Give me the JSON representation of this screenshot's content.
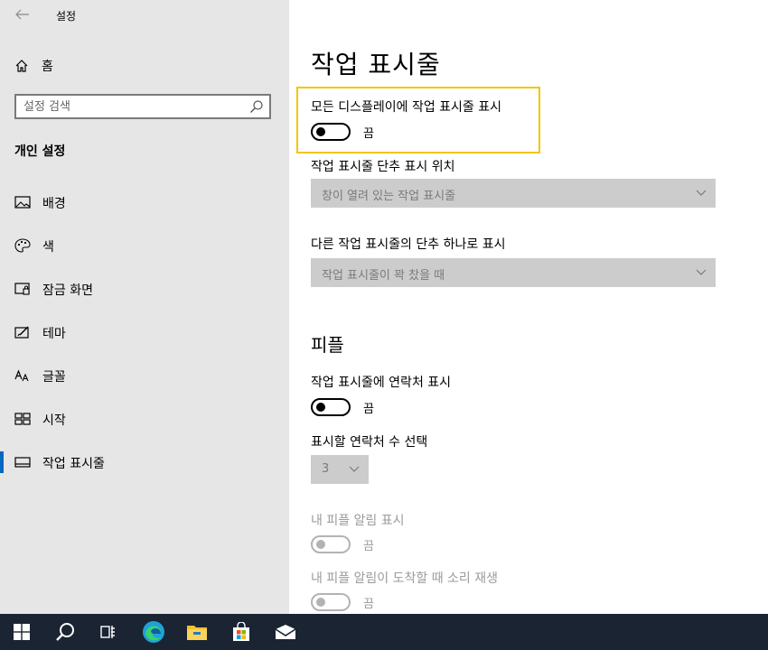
{
  "window": {
    "title": "설정"
  },
  "sidebar": {
    "home_label": "홈",
    "search_placeholder": "설정 검색",
    "section_title": "개인 설정",
    "items": [
      {
        "label": "배경",
        "icon": "picture-icon"
      },
      {
        "label": "색",
        "icon": "palette-icon"
      },
      {
        "label": "잠금 화면",
        "icon": "lock-screen-icon"
      },
      {
        "label": "테마",
        "icon": "theme-icon"
      },
      {
        "label": "글꼴",
        "icon": "font-icon"
      },
      {
        "label": "시작",
        "icon": "start-icon"
      },
      {
        "label": "작업 표시줄",
        "icon": "taskbar-icon",
        "selected": true
      }
    ]
  },
  "main": {
    "title": "작업 표시줄",
    "show_all_displays": {
      "label": "모든 디스플레이에 작업 표시줄 표시",
      "state": "끔",
      "on": false
    },
    "button_location": {
      "label": "작업 표시줄 단추 표시 위치",
      "value": "창이 열려 있는 작업 표시줄"
    },
    "combine_buttons": {
      "label": "다른 작업 표시줄의 단추 하나로 표시",
      "value": "작업 표시줄이 꽉 찼을 때"
    },
    "people_heading": "피플",
    "show_contacts": {
      "label": "작업 표시줄에 연락처 표시",
      "state": "끔",
      "on": false
    },
    "contacts_count": {
      "label": "표시할 연락처 수 선택",
      "value": "3"
    },
    "show_notifications": {
      "label": "내 피플 알림 표시",
      "state": "끔",
      "on": false
    },
    "notification_sound": {
      "label": "내 피플 알림이 도착할 때 소리 재생",
      "state": "끔",
      "on": false
    }
  },
  "colors": {
    "accent": "#0067c0",
    "highlight": "#f5c400",
    "taskbar": "#1a2433",
    "sidebar_bg": "#e6e6e6",
    "dropdown_bg": "#cccccc"
  },
  "taskbar": {
    "icons": [
      "windows-start-icon",
      "search-icon",
      "task-view-icon",
      "edge-icon",
      "file-explorer-icon",
      "store-icon",
      "mail-icon"
    ]
  }
}
